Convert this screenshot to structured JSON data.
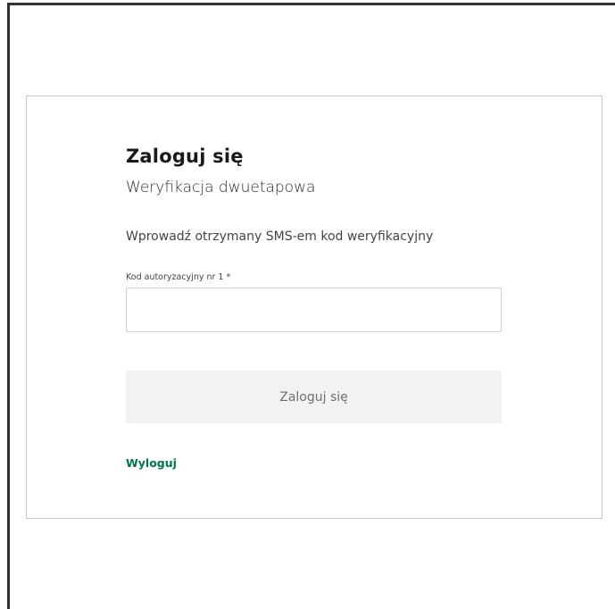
{
  "login": {
    "title": "Zaloguj się",
    "subtitle": "Weryfikacja dwuetapowa",
    "instruction": "Wprowadź otrzymany SMS-em kod weryfikacyjny",
    "code_field": {
      "label": "Kod autoryzacyjny nr 1 *",
      "value": "",
      "placeholder": ""
    },
    "submit_label": "Zaloguj się",
    "logout_label": "Wyloguj"
  },
  "colors": {
    "link": "#00764b",
    "button_bg": "#f2f2f2",
    "button_text": "#6f6f6f",
    "frame_border": "#2f3337"
  }
}
